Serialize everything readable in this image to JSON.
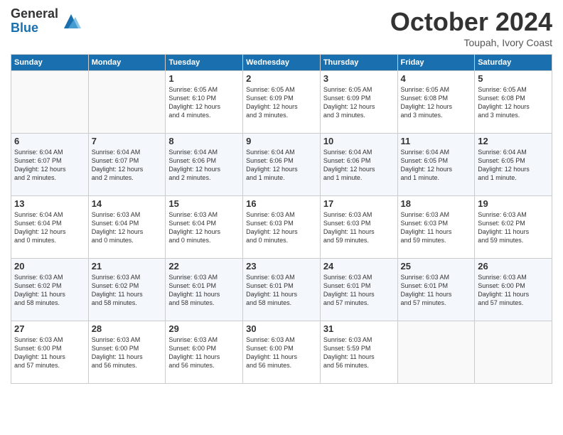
{
  "logo": {
    "general": "General",
    "blue": "Blue"
  },
  "title": "October 2024",
  "subtitle": "Toupah, Ivory Coast",
  "days_header": [
    "Sunday",
    "Monday",
    "Tuesday",
    "Wednesday",
    "Thursday",
    "Friday",
    "Saturday"
  ],
  "weeks": [
    [
      {
        "num": "",
        "detail": ""
      },
      {
        "num": "",
        "detail": ""
      },
      {
        "num": "1",
        "detail": "Sunrise: 6:05 AM\nSunset: 6:10 PM\nDaylight: 12 hours\nand 4 minutes."
      },
      {
        "num": "2",
        "detail": "Sunrise: 6:05 AM\nSunset: 6:09 PM\nDaylight: 12 hours\nand 3 minutes."
      },
      {
        "num": "3",
        "detail": "Sunrise: 6:05 AM\nSunset: 6:09 PM\nDaylight: 12 hours\nand 3 minutes."
      },
      {
        "num": "4",
        "detail": "Sunrise: 6:05 AM\nSunset: 6:08 PM\nDaylight: 12 hours\nand 3 minutes."
      },
      {
        "num": "5",
        "detail": "Sunrise: 6:05 AM\nSunset: 6:08 PM\nDaylight: 12 hours\nand 3 minutes."
      }
    ],
    [
      {
        "num": "6",
        "detail": "Sunrise: 6:04 AM\nSunset: 6:07 PM\nDaylight: 12 hours\nand 2 minutes."
      },
      {
        "num": "7",
        "detail": "Sunrise: 6:04 AM\nSunset: 6:07 PM\nDaylight: 12 hours\nand 2 minutes."
      },
      {
        "num": "8",
        "detail": "Sunrise: 6:04 AM\nSunset: 6:06 PM\nDaylight: 12 hours\nand 2 minutes."
      },
      {
        "num": "9",
        "detail": "Sunrise: 6:04 AM\nSunset: 6:06 PM\nDaylight: 12 hours\nand 1 minute."
      },
      {
        "num": "10",
        "detail": "Sunrise: 6:04 AM\nSunset: 6:06 PM\nDaylight: 12 hours\nand 1 minute."
      },
      {
        "num": "11",
        "detail": "Sunrise: 6:04 AM\nSunset: 6:05 PM\nDaylight: 12 hours\nand 1 minute."
      },
      {
        "num": "12",
        "detail": "Sunrise: 6:04 AM\nSunset: 6:05 PM\nDaylight: 12 hours\nand 1 minute."
      }
    ],
    [
      {
        "num": "13",
        "detail": "Sunrise: 6:04 AM\nSunset: 6:04 PM\nDaylight: 12 hours\nand 0 minutes."
      },
      {
        "num": "14",
        "detail": "Sunrise: 6:03 AM\nSunset: 6:04 PM\nDaylight: 12 hours\nand 0 minutes."
      },
      {
        "num": "15",
        "detail": "Sunrise: 6:03 AM\nSunset: 6:04 PM\nDaylight: 12 hours\nand 0 minutes."
      },
      {
        "num": "16",
        "detail": "Sunrise: 6:03 AM\nSunset: 6:03 PM\nDaylight: 12 hours\nand 0 minutes."
      },
      {
        "num": "17",
        "detail": "Sunrise: 6:03 AM\nSunset: 6:03 PM\nDaylight: 11 hours\nand 59 minutes."
      },
      {
        "num": "18",
        "detail": "Sunrise: 6:03 AM\nSunset: 6:03 PM\nDaylight: 11 hours\nand 59 minutes."
      },
      {
        "num": "19",
        "detail": "Sunrise: 6:03 AM\nSunset: 6:02 PM\nDaylight: 11 hours\nand 59 minutes."
      }
    ],
    [
      {
        "num": "20",
        "detail": "Sunrise: 6:03 AM\nSunset: 6:02 PM\nDaylight: 11 hours\nand 58 minutes."
      },
      {
        "num": "21",
        "detail": "Sunrise: 6:03 AM\nSunset: 6:02 PM\nDaylight: 11 hours\nand 58 minutes."
      },
      {
        "num": "22",
        "detail": "Sunrise: 6:03 AM\nSunset: 6:01 PM\nDaylight: 11 hours\nand 58 minutes."
      },
      {
        "num": "23",
        "detail": "Sunrise: 6:03 AM\nSunset: 6:01 PM\nDaylight: 11 hours\nand 58 minutes."
      },
      {
        "num": "24",
        "detail": "Sunrise: 6:03 AM\nSunset: 6:01 PM\nDaylight: 11 hours\nand 57 minutes."
      },
      {
        "num": "25",
        "detail": "Sunrise: 6:03 AM\nSunset: 6:01 PM\nDaylight: 11 hours\nand 57 minutes."
      },
      {
        "num": "26",
        "detail": "Sunrise: 6:03 AM\nSunset: 6:00 PM\nDaylight: 11 hours\nand 57 minutes."
      }
    ],
    [
      {
        "num": "27",
        "detail": "Sunrise: 6:03 AM\nSunset: 6:00 PM\nDaylight: 11 hours\nand 57 minutes."
      },
      {
        "num": "28",
        "detail": "Sunrise: 6:03 AM\nSunset: 6:00 PM\nDaylight: 11 hours\nand 56 minutes."
      },
      {
        "num": "29",
        "detail": "Sunrise: 6:03 AM\nSunset: 6:00 PM\nDaylight: 11 hours\nand 56 minutes."
      },
      {
        "num": "30",
        "detail": "Sunrise: 6:03 AM\nSunset: 6:00 PM\nDaylight: 11 hours\nand 56 minutes."
      },
      {
        "num": "31",
        "detail": "Sunrise: 6:03 AM\nSunset: 5:59 PM\nDaylight: 11 hours\nand 56 minutes."
      },
      {
        "num": "",
        "detail": ""
      },
      {
        "num": "",
        "detail": ""
      }
    ]
  ]
}
